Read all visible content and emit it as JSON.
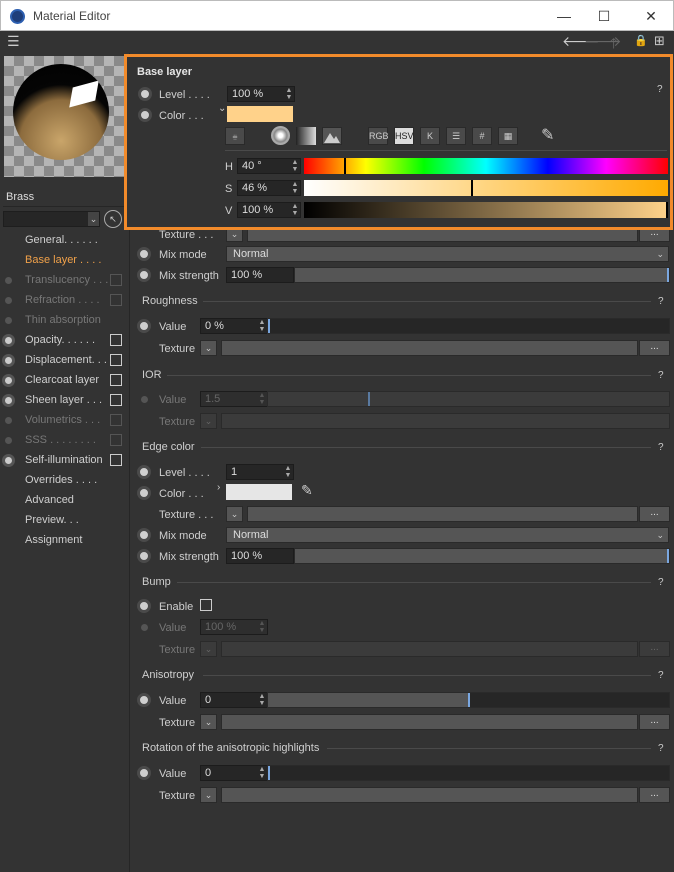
{
  "window": {
    "title": "Material Editor",
    "minimize": "—",
    "maximize": "☐",
    "close": "✕"
  },
  "toolbar": {
    "menu": "☰",
    "back": "🡐",
    "forward": "🡒",
    "up": "🡑",
    "lock": "🔒",
    "newwin": "⊞"
  },
  "sidebar": {
    "material_name": "Brass",
    "items": [
      {
        "label": "General. . . . . ."
      },
      {
        "label": "Base layer . . . ."
      },
      {
        "label": "Translucency . . ."
      },
      {
        "label": "Refraction . . . ."
      },
      {
        "label": "Thin absorption"
      },
      {
        "label": "Opacity. . . . . ."
      },
      {
        "label": "Displacement. . ."
      },
      {
        "label": "Clearcoat layer"
      },
      {
        "label": "Sheen layer . . ."
      },
      {
        "label": "Volumetrics . . ."
      },
      {
        "label": "SSS . . . . . . . ."
      },
      {
        "label": "Self-illumination"
      },
      {
        "label": "Overrides . . . ."
      },
      {
        "label": "Advanced"
      },
      {
        "label": "Preview. . ."
      },
      {
        "label": "Assignment"
      }
    ]
  },
  "popup": {
    "title": "Base layer",
    "level_label": "Level . . . .",
    "level_value": "100 %",
    "color_label": "Color . . .",
    "color_hex": "#ffd28a",
    "modes": [
      "RGB",
      "HSV",
      "K"
    ],
    "hash": "#",
    "h_label": "H",
    "h_value": "40 °",
    "h": 40,
    "s_label": "S",
    "s_value": "46 %",
    "s": 46,
    "v_label": "V",
    "v_value": "100 %",
    "v": 100,
    "help": "?"
  },
  "base": {
    "texture_label": "Texture . . .",
    "mix_mode_label": "Mix mode",
    "mix_mode_value": "Normal",
    "mix_strength_label": "Mix strength",
    "mix_strength_value": "100 %"
  },
  "roughness": {
    "title": "Roughness",
    "value_label": "Value",
    "value": "0 %",
    "texture_label": "Texture",
    "help": "?"
  },
  "ior": {
    "title": "IOR",
    "value_label": "Value",
    "value": "1.5",
    "texture_label": "Texture",
    "help": "?"
  },
  "edge": {
    "title": "Edge color",
    "help": "?",
    "level_label": "Level . . . .",
    "level_value": "1",
    "color_label": "Color . . .",
    "color_hex": "#e6e6e6",
    "texture_label": "Texture . . .",
    "mix_mode_label": "Mix mode",
    "mix_mode_value": "Normal",
    "mix_strength_label": "Mix strength",
    "mix_strength_value": "100 %"
  },
  "bump": {
    "title": "Bump",
    "help": "?",
    "enable_label": "Enable",
    "value_label": "Value",
    "value": "100 %",
    "texture_label": "Texture"
  },
  "anisotropy": {
    "title": "Anisotropy",
    "help": "?",
    "value_label": "Value",
    "value": "0",
    "texture_label": "Texture"
  },
  "rotation": {
    "title": "Rotation of the anisotropic highlights",
    "help": "?",
    "value_label": "Value",
    "value": "0",
    "texture_label": "Texture"
  },
  "common": {
    "dots": "...",
    "spin": "▲▼",
    "drop": "⌄",
    "arrow": "⌄"
  }
}
